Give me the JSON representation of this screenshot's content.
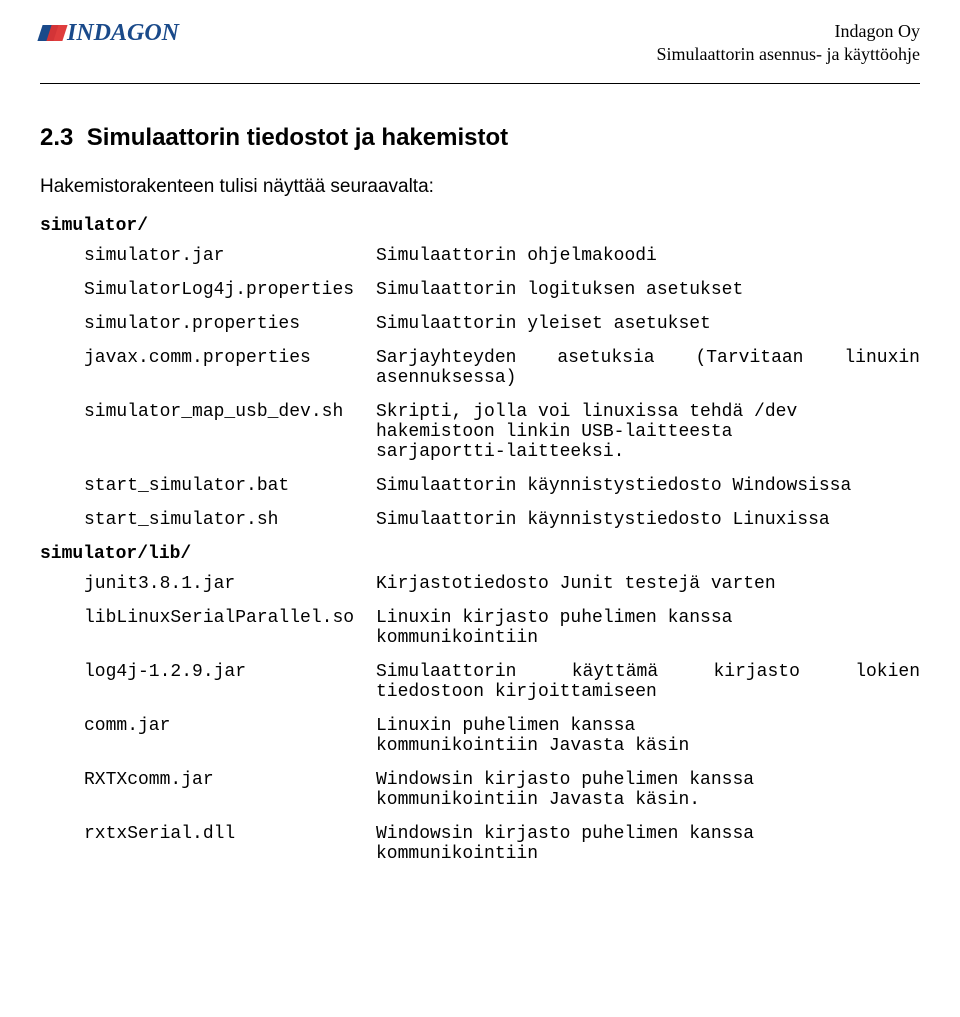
{
  "header": {
    "logo_text": "INDAGON",
    "company": "Indagon Oy",
    "doc_title": "Simulaattorin asennus- ja käyttöohje"
  },
  "section": {
    "number": "2.3",
    "title": "Simulaattorin tiedostot ja hakemistot",
    "intro": "Hakemistorakenteen tulisi näyttää seuraavalta:"
  },
  "dirs": {
    "simulator": "simulator/",
    "simulator_lib": "simulator/lib/"
  },
  "files": {
    "simulator": [
      {
        "name": "simulator.jar",
        "desc": "Simulaattorin ohjelmakoodi"
      },
      {
        "name": "SimulatorLog4j.properties",
        "desc": "Simulaattorin logituksen asetukset"
      },
      {
        "name": "simulator.properties",
        "desc": "Simulaattorin yleiset asetukset"
      },
      {
        "name": "javax.comm.properties",
        "desc_l1": "Sarjayhteyden asetuksia (Tarvitaan linuxin",
        "desc_l2": "asennuksessa)",
        "justify": true
      },
      {
        "name": "simulator_map_usb_dev.sh",
        "desc": "Skripti, jolla voi linuxissa tehdä /dev\nhakemistoon linkin USB-laitteesta\nsarjaportti-laitteeksi."
      },
      {
        "name": "start_simulator.bat",
        "desc": "Simulaattorin käynnistystiedosto Windowsissa"
      },
      {
        "name": "start_simulator.sh",
        "desc": "Simulaattorin käynnistystiedosto Linuxissa"
      }
    ],
    "simulator_lib": [
      {
        "name": "junit3.8.1.jar",
        "desc": "Kirjastotiedosto Junit testejä varten"
      },
      {
        "name": "libLinuxSerialParallel.so",
        "desc": "Linuxin kirjasto puhelimen kanssa\nkommunikointiin"
      },
      {
        "name": "log4j-1.2.9.jar",
        "desc_l1": "Simulaattorin käyttämä kirjasto lokien",
        "desc_l2": "tiedostoon kirjoittamiseen",
        "justify": true
      },
      {
        "name": "comm.jar",
        "desc": "Linuxin puhelimen kanssa\nkommunikointiin Javasta käsin"
      },
      {
        "name": "RXTXcomm.jar",
        "desc": "Windowsin kirjasto puhelimen kanssa\nkommunikointiin Javasta käsin."
      },
      {
        "name": "rxtxSerial.dll",
        "desc": "Windowsin kirjasto puhelimen kanssa\nkommunikointiin"
      }
    ]
  }
}
